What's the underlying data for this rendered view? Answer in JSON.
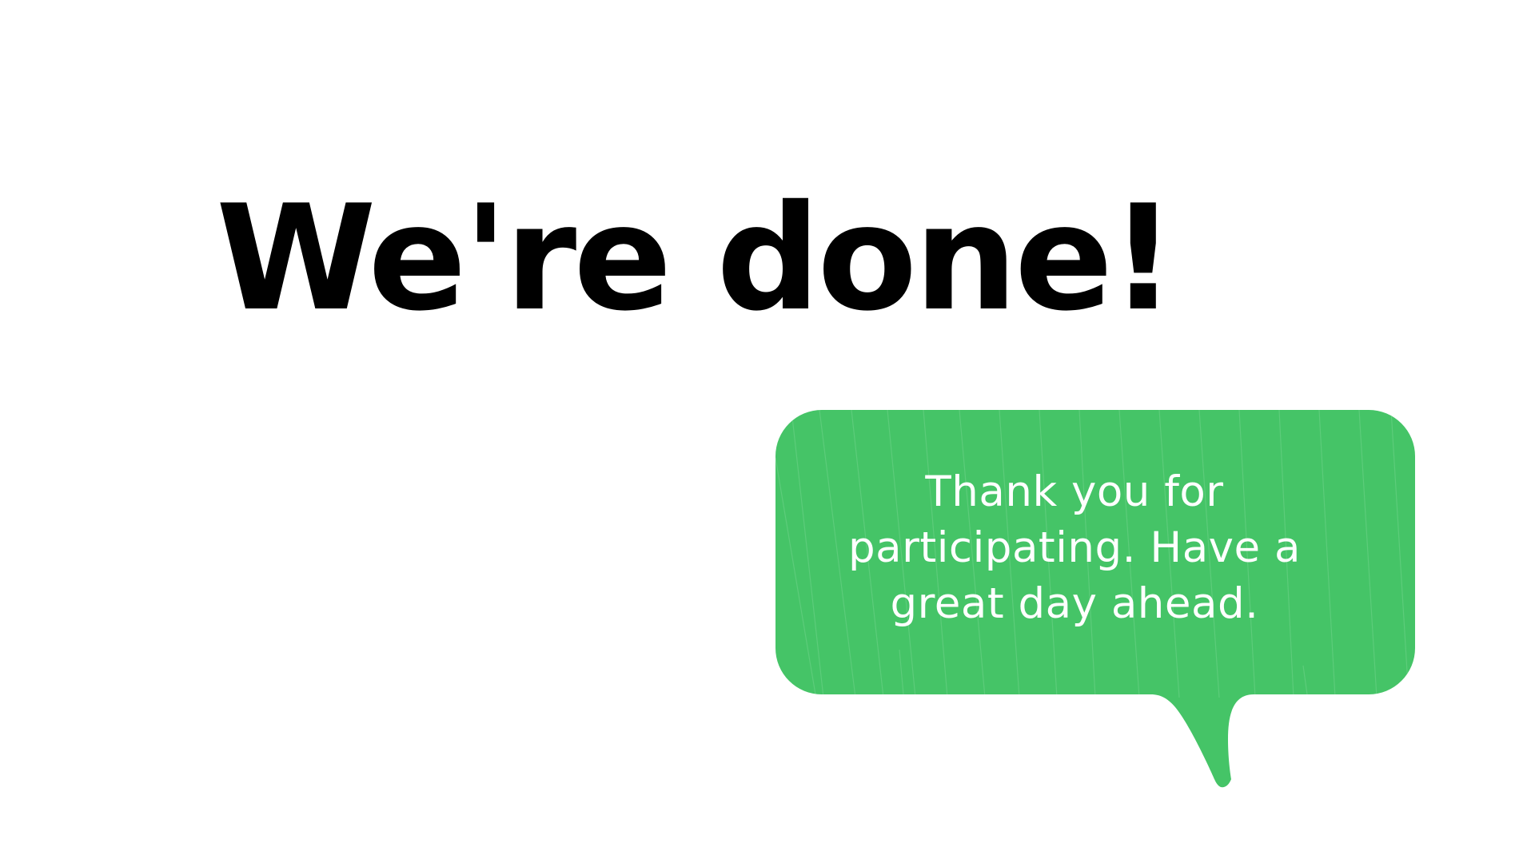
{
  "slide": {
    "headline": "We're done!",
    "message": "Thank you for participating. Have a great day ahead.",
    "bubble_color": "#45c467",
    "text_color": "#000000",
    "message_text_color": "#ffffff",
    "background_color": "#ffffff"
  }
}
